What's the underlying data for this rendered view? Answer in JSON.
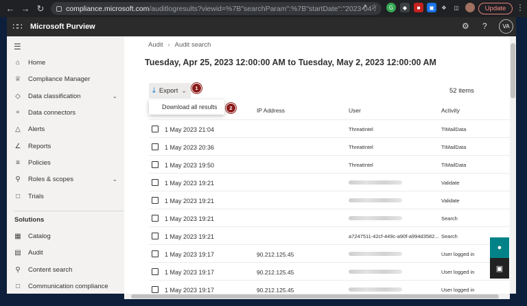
{
  "browser": {
    "url_host": "compliance.microsoft.com",
    "url_rest": "/auditlogresults?viewid=%7B\"searchParam\":%7B\"startDate\":\"2023-04-24T23:00:00...",
    "update_label": "Update"
  },
  "app": {
    "title": "Microsoft Purview",
    "avatar_initials": "VA"
  },
  "nav": {
    "items": [
      {
        "label": "Home",
        "icon": "home-icon"
      },
      {
        "label": "Compliance Manager",
        "icon": "trophy-icon"
      },
      {
        "label": "Data classification",
        "icon": "tag-icon"
      },
      {
        "label": "Data connectors",
        "icon": "connector-icon"
      },
      {
        "label": "Alerts",
        "icon": "warning-icon"
      },
      {
        "label": "Reports",
        "icon": "chart-icon"
      },
      {
        "label": "Policies",
        "icon": "policy-icon"
      },
      {
        "label": "Roles & scopes",
        "icon": "roles-icon"
      },
      {
        "label": "Trials",
        "icon": "trials-icon"
      }
    ],
    "section_title": "Solutions",
    "solutions": [
      {
        "label": "Catalog",
        "icon": "catalog-icon"
      },
      {
        "label": "Audit",
        "icon": "audit-icon"
      },
      {
        "label": "Content search",
        "icon": "search-icon"
      },
      {
        "label": "Communication compliance",
        "icon": "chat-icon"
      }
    ]
  },
  "main": {
    "breadcrumb": [
      "Audit",
      "Audit search"
    ],
    "title": "Tuesday, Apr 25, 2023 12:00:00 AM to Tuesday, May 2, 2023 12:00:00 AM",
    "export_label": "Export",
    "menu_item": "Download all results",
    "badge1": "1",
    "badge2": "2",
    "count": "52 items",
    "columns": {
      "ip": "IP Address",
      "user": "User",
      "activity": "Activity"
    },
    "rows": [
      {
        "date": "1 May 2023 21:04",
        "ip": "",
        "user": "ThreatIntel",
        "activity": "TIMailData"
      },
      {
        "date": "1 May 2023 20:36",
        "ip": "",
        "user": "ThreatIntel",
        "activity": "TIMailData"
      },
      {
        "date": "1 May 2023 19:50",
        "ip": "",
        "user": "ThreatIntel",
        "activity": "TIMailData"
      },
      {
        "date": "1 May 2023 19:21",
        "ip": "",
        "user": "",
        "activity": "Validate"
      },
      {
        "date": "1 May 2023 19:21",
        "ip": "",
        "user": "",
        "activity": "Validate"
      },
      {
        "date": "1 May 2023 19:21",
        "ip": "",
        "user": "",
        "activity": "Search"
      },
      {
        "date": "1 May 2023 19:21",
        "ip": "",
        "user": "a7247511-42cf-449c-a90f-a994d3582...",
        "activity": "Search"
      },
      {
        "date": "1 May 2023 19:17",
        "ip": "90.212.125.45",
        "user": "",
        "activity": "User logged in"
      },
      {
        "date": "1 May 2023 19:17",
        "ip": "90.212.125.45",
        "user": "",
        "activity": "User logged in"
      },
      {
        "date": "1 May 2023 19:17",
        "ip": "90.212.125.45",
        "user": "",
        "activity": "User logged in"
      }
    ]
  }
}
